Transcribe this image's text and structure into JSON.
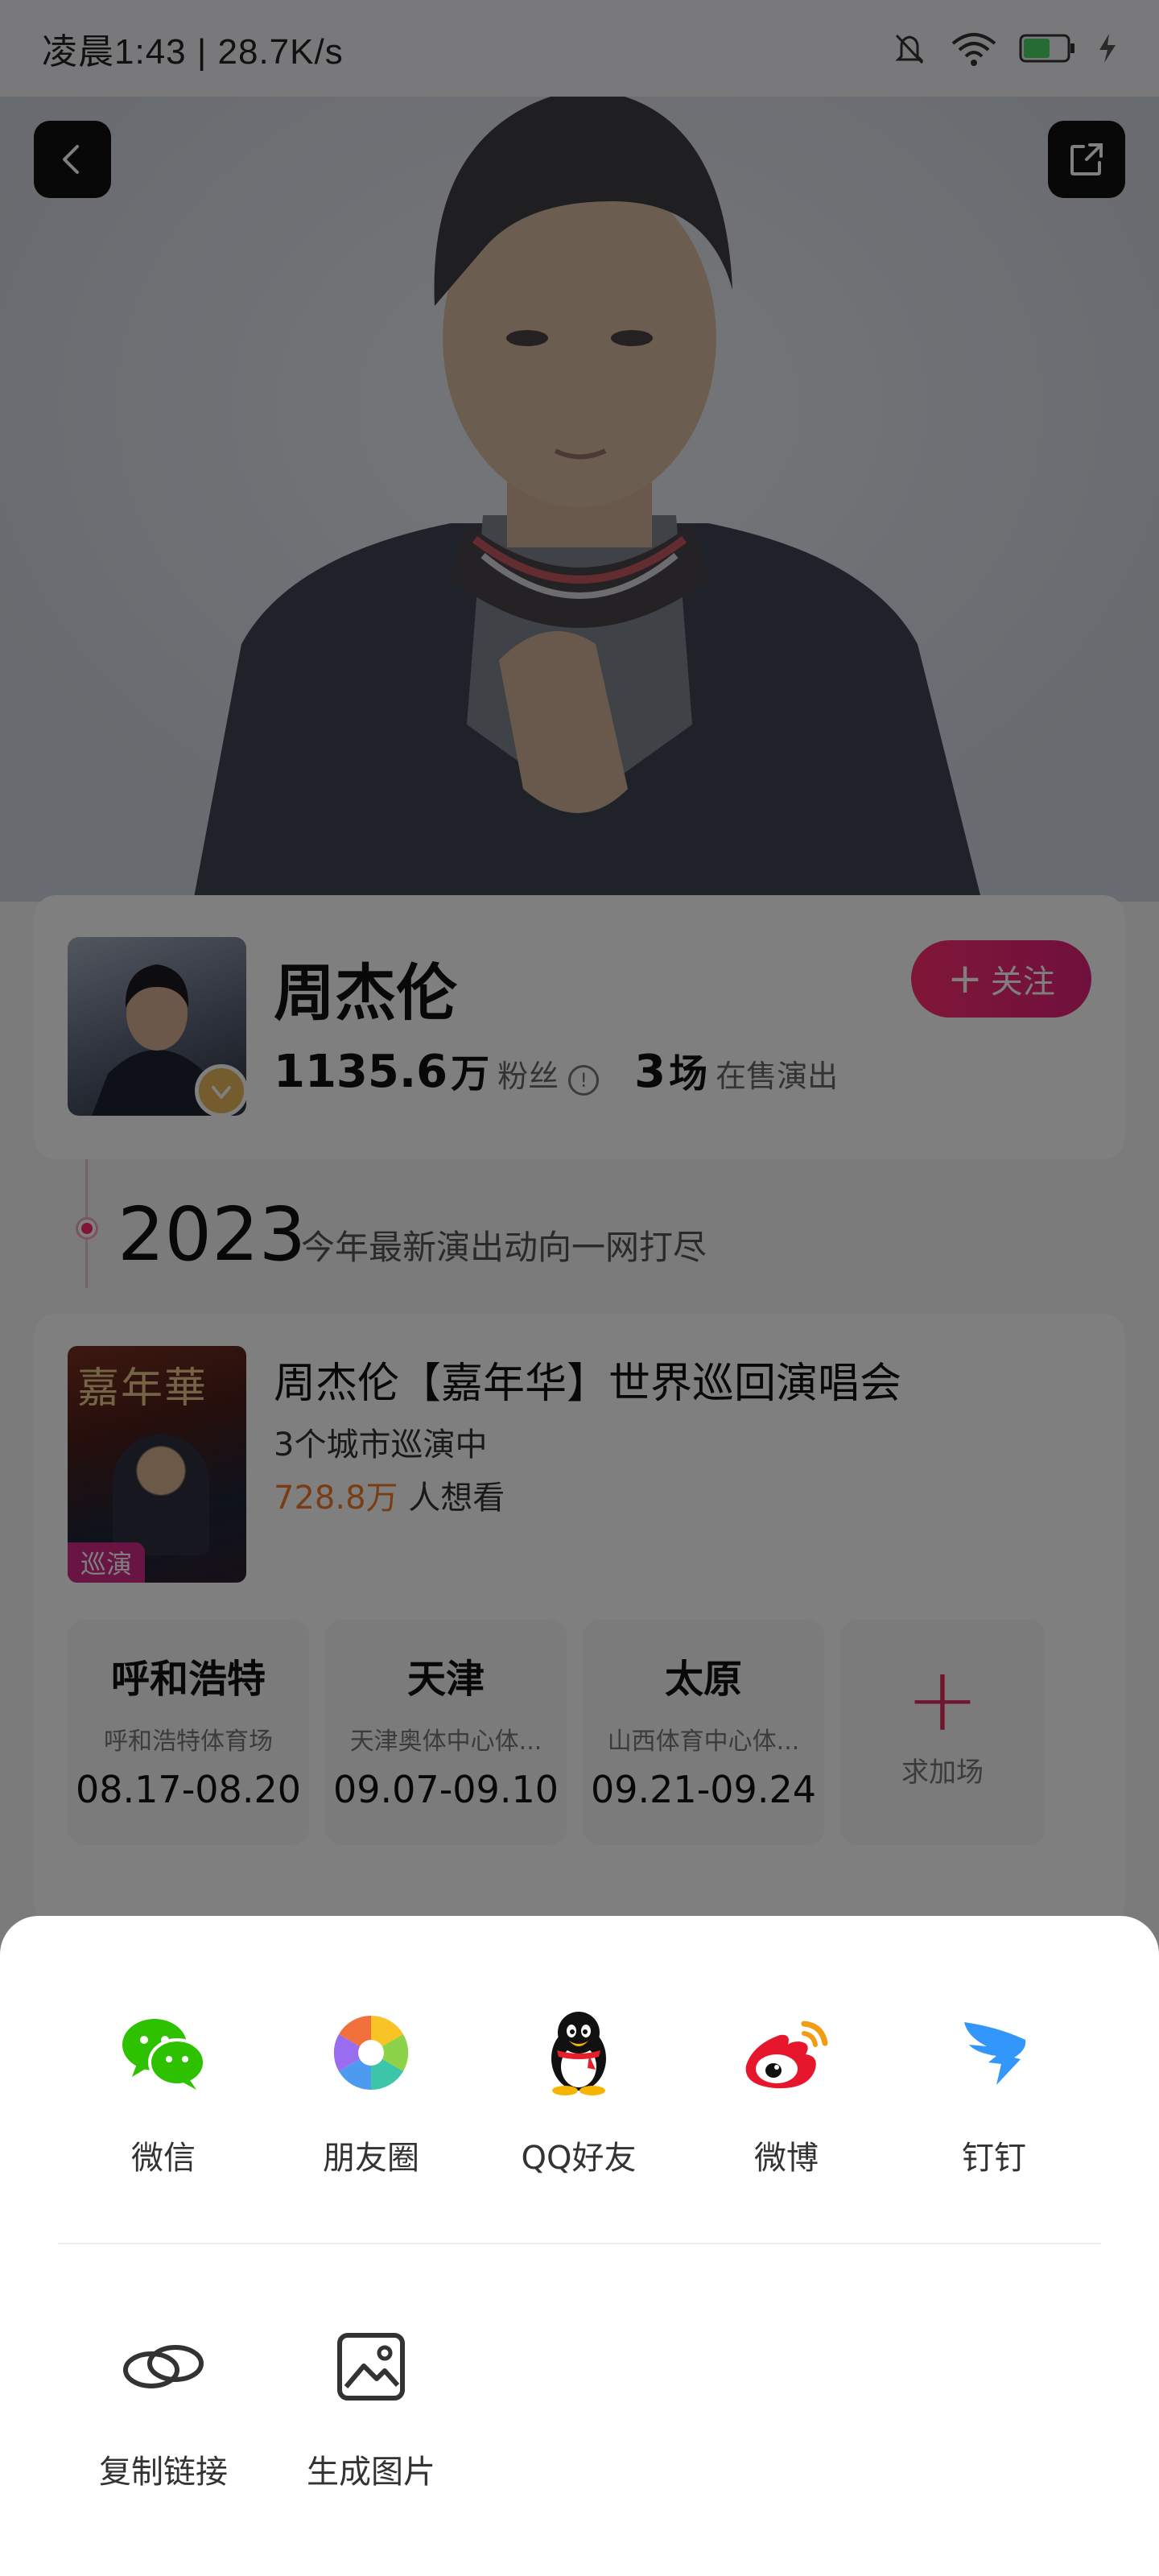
{
  "status_bar": {
    "time": "凌晨1:43 | 28.7K/s",
    "battery": "55"
  },
  "artist": {
    "name": "周杰伦",
    "follow_label": "关注",
    "fans_count": "1135.6",
    "fans_unit": "万",
    "fans_label": "粉丝",
    "shows_count": "3",
    "shows_unit": "场",
    "shows_label": "在售演出"
  },
  "timeline": {
    "year": "2023",
    "subtitle": "今年最新演出动向一网打尽"
  },
  "tour": {
    "poster_title": "嘉年華",
    "tag": "巡演",
    "title": "周杰伦【嘉年华】世界巡回演唱会",
    "cities_text": "3个城市巡演中",
    "want_count": "728.8万",
    "want_label": "人想看",
    "cities": [
      {
        "name": "呼和浩特",
        "venue": "呼和浩特体育场",
        "dates": "08.17-08.20"
      },
      {
        "name": "天津",
        "venue": "天津奥体中心体...",
        "dates": "09.07-09.10"
      },
      {
        "name": "太原",
        "venue": "山西体育中心体...",
        "dates": "09.21-09.24"
      }
    ],
    "add_label": "求加场"
  },
  "share_sheet": {
    "row1": [
      {
        "label": "微信",
        "icon": "wechat-icon"
      },
      {
        "label": "朋友圈",
        "icon": "moments-icon"
      },
      {
        "label": "QQ好友",
        "icon": "qq-icon"
      },
      {
        "label": "微博",
        "icon": "weibo-icon"
      },
      {
        "label": "钉钉",
        "icon": "dingtalk-icon"
      }
    ],
    "row2": [
      {
        "label": "复制链接",
        "icon": "link-icon"
      },
      {
        "label": "生成图片",
        "icon": "image-icon"
      }
    ]
  },
  "colors": {
    "accent": "#ff2d6f",
    "orange": "#f07a2a",
    "wechat": "#2dc100",
    "weibo": "#e6162d",
    "dingtalk": "#3296fa"
  }
}
